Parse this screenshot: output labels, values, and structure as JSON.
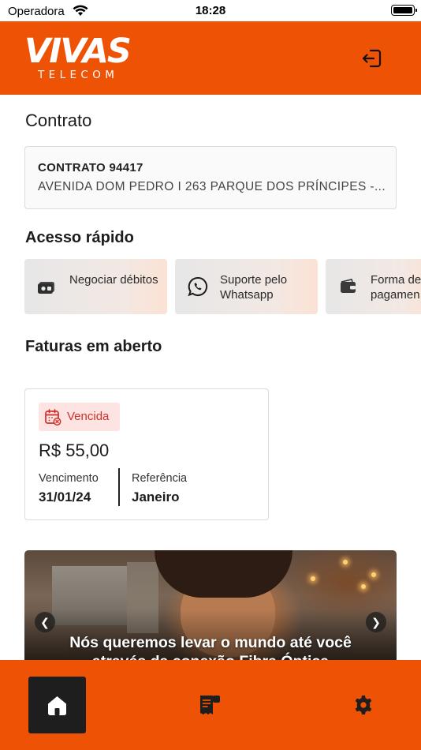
{
  "status_bar": {
    "carrier": "Operadora",
    "time": "18:28"
  },
  "header": {
    "logo_main": "VIVAS",
    "logo_sub": "TELECOM",
    "logout_icon": "logout-icon"
  },
  "contract_section": {
    "title": "Contrato",
    "number": "CONTRATO 94417",
    "address": "AVENIDA DOM PEDRO I 263 PARQUE DOS PRÍNCIPES -..."
  },
  "quick_access": {
    "title": "Acesso rápido",
    "items": [
      {
        "label": "Negociar débitos",
        "icon": "money-icon"
      },
      {
        "label": "Suporte pelo Whatsapp",
        "icon": "whatsapp-icon"
      },
      {
        "label": "Forma de pagamen",
        "icon": "wallet-icon"
      }
    ]
  },
  "invoices": {
    "title": "Faturas em aberto",
    "items": [
      {
        "status": "Vencida",
        "amount": "R$ 55,00",
        "due_label": "Vencimento",
        "due_value": "31/01/24",
        "ref_label": "Referência",
        "ref_value": "Janeiro"
      }
    ]
  },
  "banner": {
    "text_line1": "Nós queremos levar o mundo até você",
    "text_line2": "através da conexão Fibra Óptica"
  },
  "bottom_nav": {
    "items": [
      "home-icon",
      "invoice-icon",
      "settings-icon"
    ],
    "active": "home-icon"
  },
  "colors": {
    "brand": "#ee5204",
    "overdue": "#d0302a",
    "overdue_bg": "#fde3e1"
  }
}
